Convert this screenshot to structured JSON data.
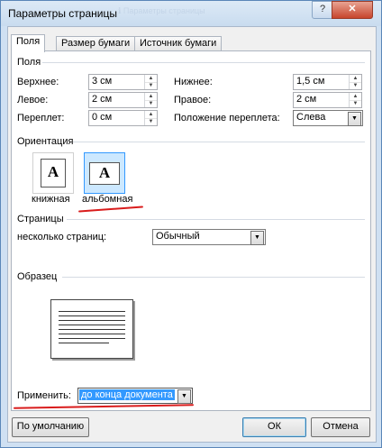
{
  "window": {
    "title": "Параметры страницы",
    "help_glyph": "?",
    "close_glyph": "✕",
    "ghost_text": "ℹ  Параметры страницы"
  },
  "tabs": [
    "Поля",
    "Размер бумаги",
    "Источник бумаги"
  ],
  "margins": {
    "section": "Поля",
    "top_label": "Верхнее:",
    "top_value": "3 см",
    "bottom_label": "Нижнее:",
    "bottom_value": "1,5 см",
    "left_label": "Левое:",
    "left_value": "2 см",
    "right_label": "Правое:",
    "right_value": "2 см",
    "gutter_label": "Переплет:",
    "gutter_value": "0 см",
    "gutter_pos_label": "Положение переплета:",
    "gutter_pos_value": "Слева"
  },
  "orientation": {
    "section": "Ориентация",
    "portrait_label": "книжная",
    "landscape_label": "альбомная",
    "glyph": "A",
    "selected": "landscape"
  },
  "pages": {
    "section": "Страницы",
    "multiple_label": "несколько страниц:",
    "multiple_value": "Обычный"
  },
  "preview": {
    "section": "Образец"
  },
  "apply": {
    "label": "Применить:",
    "value": "до конца документа"
  },
  "buttons": {
    "default": "По умолчанию",
    "ok": "ОК",
    "cancel": "Отмена"
  },
  "arrows": {
    "up": "▲",
    "down": "▼"
  },
  "colors": {
    "annotation": "#d91c1c",
    "selection": "#3399ff"
  }
}
